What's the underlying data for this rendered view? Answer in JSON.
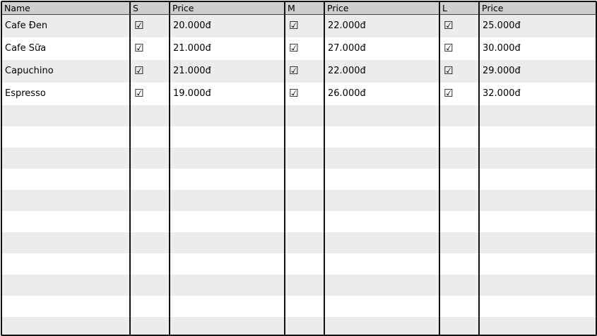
{
  "columns": {
    "name": "Name",
    "s": "S",
    "price_s": "Price",
    "m": "M",
    "price_m": "Price",
    "l": "L",
    "price_l": "Price"
  },
  "check_icon": "☑",
  "rows": [
    {
      "name": "Cafe Đen",
      "s_checked": true,
      "price_s": "20.000đ",
      "m_checked": true,
      "price_m": "22.000đ",
      "l_checked": true,
      "price_l": "25.000đ"
    },
    {
      "name": "Cafe Sữa",
      "s_checked": true,
      "price_s": "21.000đ",
      "m_checked": true,
      "price_m": "27.000đ",
      "l_checked": true,
      "price_l": "30.000đ"
    },
    {
      "name": "Capuchino",
      "s_checked": true,
      "price_s": "21.000đ",
      "m_checked": true,
      "price_m": "22.000đ",
      "l_checked": true,
      "price_l": "29.000đ"
    },
    {
      "name": "Espresso",
      "s_checked": true,
      "price_s": "19.000đ",
      "m_checked": true,
      "price_m": "26.000đ",
      "l_checked": true,
      "price_l": "32.000đ"
    }
  ],
  "empty_rows": 11
}
